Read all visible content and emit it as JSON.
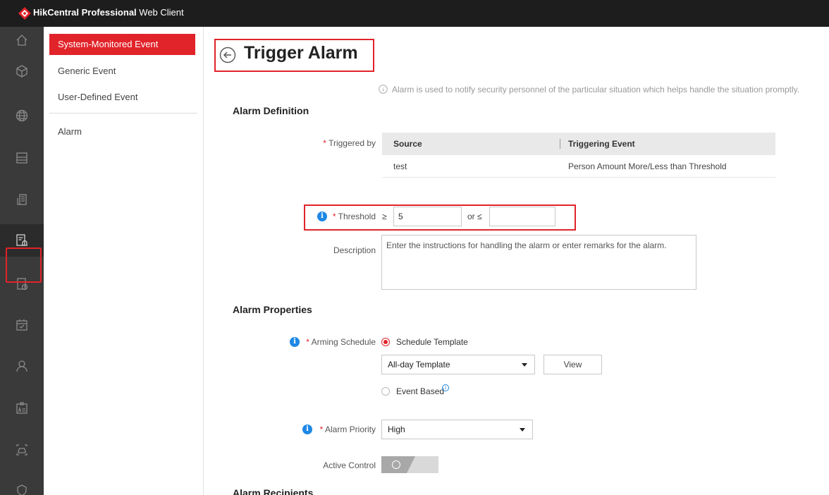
{
  "app": {
    "title_bold": "HikCentral Professional",
    "title_light": "Web Client",
    "accent_color": "#e1232a"
  },
  "rail": {
    "icons": [
      "home-icon",
      "cube-icon",
      "globe-icon",
      "server-icon",
      "building-icon",
      "event-alarm-icon",
      "record-icon",
      "calendar-icon",
      "person-icon",
      "id-card-icon",
      "vehicle-icon",
      "shield-icon"
    ],
    "active_index": 5
  },
  "subnav": {
    "items": [
      {
        "label": "System-Monitored Event",
        "active": true
      },
      {
        "label": "Generic Event",
        "active": false
      },
      {
        "label": "User-Defined Event",
        "active": false
      },
      {
        "label": "Alarm",
        "active": false
      }
    ]
  },
  "page": {
    "title": "Trigger Alarm",
    "hint": "Alarm is used to notify security personnel of the particular situation which helps handle the situation promptly."
  },
  "alarm_definition": {
    "section_title": "Alarm Definition",
    "triggered_by_label": "Triggered by",
    "table_headers": [
      "Source",
      "Triggering Event"
    ],
    "table_rows": [
      {
        "source": "test",
        "event": "Person Amount More/Less than Threshold"
      }
    ],
    "threshold_label": "Threshold",
    "threshold_ge_symbol": "≥",
    "threshold_ge_value": "5",
    "threshold_or_le": "or ≤",
    "threshold_le_value": "",
    "description_label": "Description",
    "description_placeholder": "Enter the instructions for handling the alarm or enter remarks for the alarm."
  },
  "alarm_properties": {
    "section_title": "Alarm Properties",
    "arming_schedule_label": "Arming Schedule",
    "schedule_template_option": "Schedule Template",
    "schedule_template_selected": true,
    "template_select_value": "All-day Template",
    "view_button": "View",
    "event_based_option": "Event Based",
    "alarm_priority_label": "Alarm Priority",
    "alarm_priority_value": "High",
    "active_control_label": "Active Control",
    "active_control_on": false
  },
  "next_section_title": "Alarm Recipients"
}
